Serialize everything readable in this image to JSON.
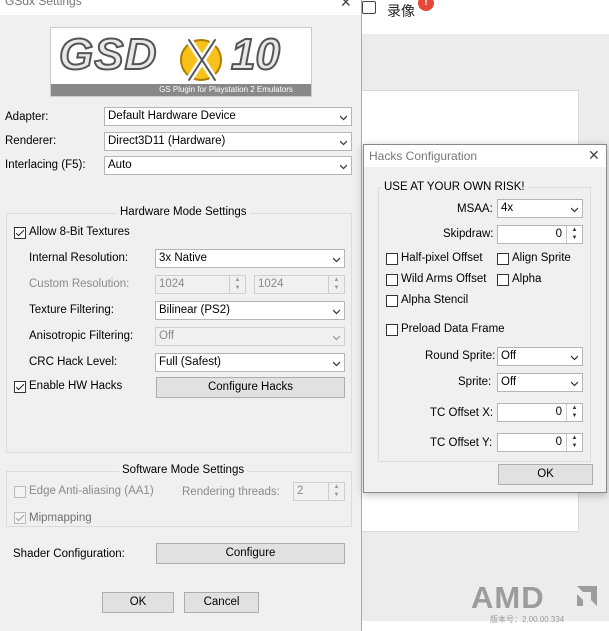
{
  "background_app": {
    "record_label": "录像",
    "badge": "!",
    "logo": "AMD",
    "footer_text": "版本号：2.00.00.334"
  },
  "gsdx": {
    "title": "GSdx Settings",
    "close": "✕",
    "logo": {
      "main": "GSD",
      "version": "10",
      "subtitle": "GS Plugin for Playstation 2 Emulators"
    },
    "adapter": {
      "label": "Adapter:",
      "value": "Default Hardware Device"
    },
    "renderer": {
      "label": "Renderer:",
      "value": "Direct3D11 (Hardware)"
    },
    "interlacing": {
      "label": "Interlacing (F5):",
      "value": "Auto"
    },
    "hw_group": {
      "title": "Hardware Mode Settings",
      "allow_8bit": {
        "label": "Allow 8-Bit Textures",
        "checked": true
      },
      "internal_resolution": {
        "label": "Internal Resolution:",
        "value": "3x Native"
      },
      "custom_resolution": {
        "label": "Custom Resolution:",
        "width": "1024",
        "height": "1024"
      },
      "texture_filtering": {
        "label": "Texture Filtering:",
        "value": "Bilinear (PS2)"
      },
      "anisotropic": {
        "label": "Anisotropic Filtering:",
        "value": "Off"
      },
      "crc_hack": {
        "label": "CRC Hack Level:",
        "value": "Full (Safest)"
      },
      "enable_hw_hacks": {
        "label": "Enable HW Hacks",
        "checked": true
      },
      "configure_hacks": "Configure Hacks"
    },
    "sw_group": {
      "title": "Software Mode Settings",
      "edge_aa": {
        "label": "Edge Anti-aliasing (AA1)",
        "checked": false
      },
      "rendering_threads": {
        "label": "Rendering threads:",
        "value": "2"
      },
      "mipmapping": {
        "label": "Mipmapping",
        "checked": true
      }
    },
    "shader": {
      "label": "Shader Configuration:",
      "button": "Configure"
    },
    "ok": "OK",
    "cancel": "Cancel"
  },
  "hacks": {
    "title": "Hacks Configuration",
    "close": "✕",
    "warning": "USE AT YOUR OWN RISK!",
    "msaa": {
      "label": "MSAA:",
      "value": "4x"
    },
    "skipdraw": {
      "label": "Skipdraw:",
      "value": "0"
    },
    "half_pixel": {
      "label": "Half-pixel Offset",
      "checked": false
    },
    "align_sprite": {
      "label": "Align Sprite",
      "checked": false
    },
    "wild_arms": {
      "label": "Wild Arms Offset",
      "checked": false
    },
    "alpha": {
      "label": "Alpha",
      "checked": false
    },
    "alpha_stencil": {
      "label": "Alpha Stencil",
      "checked": false
    },
    "preload": {
      "label": "Preload Data Frame",
      "checked": false
    },
    "round_sprite": {
      "label": "Round Sprite:",
      "value": "Off"
    },
    "sprite": {
      "label": "Sprite:",
      "value": "Off"
    },
    "tc_offset_x": {
      "label": "TC Offset X:",
      "value": "0"
    },
    "tc_offset_y": {
      "label": "TC Offset Y:",
      "value": "0"
    },
    "ok": "OK"
  }
}
